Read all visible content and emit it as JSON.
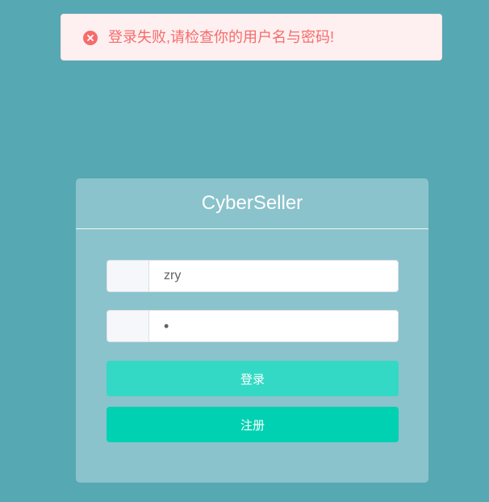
{
  "toast": {
    "icon": "error-circle-icon",
    "message": "登录失败,请检查你的用户名与密码!",
    "color": "#f56c6c"
  },
  "card": {
    "title": "CyberSeller"
  },
  "form": {
    "username_value": "zry",
    "password_value": "•"
  },
  "buttons": {
    "login_label": "登录",
    "register_label": "注册"
  },
  "colors": {
    "background": "#56a8b3",
    "card": "#8ac3cc",
    "login_button": "#33d9c4",
    "register_button": "#00d1b2"
  }
}
